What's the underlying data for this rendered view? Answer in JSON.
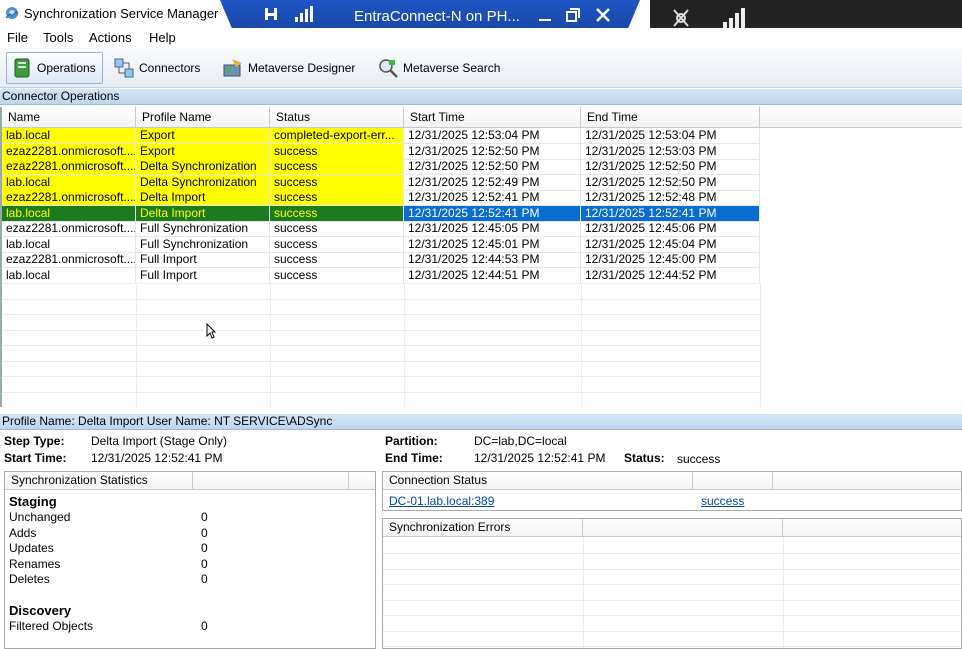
{
  "window": {
    "title": "Synchronization Service Manager",
    "rdp_title": "EntraConnect-N on PH..."
  },
  "menu": [
    "File",
    "Tools",
    "Actions",
    "Help"
  ],
  "toolbar": {
    "operations": "Operations",
    "connectors": "Connectors",
    "metaverse_designer": "Metaverse Designer",
    "metaverse_search": "Metaverse Search"
  },
  "connector_operations": {
    "header": "Connector Operations",
    "columns": [
      "Name",
      "Profile Name",
      "Status",
      "Start Time",
      "End Time"
    ],
    "rows": [
      {
        "name": "lab.local",
        "profile": "Export",
        "status": "completed-export-err...",
        "start": "12/31/2025 12:53:04 PM",
        "end": "12/31/2025 12:53:04 PM",
        "state": "yellow"
      },
      {
        "name": "ezaz2281.onmicrosoft....",
        "profile": "Export",
        "status": "success",
        "start": "12/31/2025 12:52:50 PM",
        "end": "12/31/2025 12:53:03 PM",
        "state": "yellow"
      },
      {
        "name": "ezaz2281.onmicrosoft....",
        "profile": "Delta Synchronization",
        "status": "success",
        "start": "12/31/2025 12:52:50 PM",
        "end": "12/31/2025 12:52:50 PM",
        "state": "yellow"
      },
      {
        "name": "lab.local",
        "profile": "Delta Synchronization",
        "status": "success",
        "start": "12/31/2025 12:52:49 PM",
        "end": "12/31/2025 12:52:50 PM",
        "state": "yellow"
      },
      {
        "name": "ezaz2281.onmicrosoft....",
        "profile": "Delta Import",
        "status": "success",
        "start": "12/31/2025 12:52:41 PM",
        "end": "12/31/2025 12:52:48 PM",
        "state": "yellow"
      },
      {
        "name": "lab.local",
        "profile": "Delta Import",
        "status": "success",
        "start": "12/31/2025 12:52:41 PM",
        "end": "12/31/2025 12:52:41 PM",
        "state": "selected"
      },
      {
        "name": "ezaz2281.onmicrosoft....",
        "profile": "Full Synchronization",
        "status": "success",
        "start": "12/31/2025 12:45:05 PM",
        "end": "12/31/2025 12:45:06 PM",
        "state": "normal"
      },
      {
        "name": "lab.local",
        "profile": "Full Synchronization",
        "status": "success",
        "start": "12/31/2025 12:45:01 PM",
        "end": "12/31/2025 12:45:04 PM",
        "state": "normal"
      },
      {
        "name": "ezaz2281.onmicrosoft....",
        "profile": "Full Import",
        "status": "success",
        "start": "12/31/2025 12:44:53 PM",
        "end": "12/31/2025 12:45:00 PM",
        "state": "normal"
      },
      {
        "name": "lab.local",
        "profile": "Full Import",
        "status": "success",
        "start": "12/31/2025 12:44:51 PM",
        "end": "12/31/2025 12:44:52 PM",
        "state": "normal"
      }
    ]
  },
  "details": {
    "header": "Profile Name: Delta Import  User Name: NT SERVICE\\ADSync",
    "step_type_label": "Step Type:",
    "step_type": "Delta Import (Stage Only)",
    "start_time_label": "Start Time:",
    "start_time": "12/31/2025 12:52:41 PM",
    "partition_label": "Partition:",
    "partition": "DC=lab,DC=local",
    "end_time_label": "End Time:",
    "end_time": "12/31/2025 12:52:41 PM",
    "status_label": "Status:",
    "status": "success"
  },
  "sync_stats": {
    "header": "Synchronization Statistics",
    "staging_label": "Staging",
    "staging": [
      {
        "label": "Unchanged",
        "value": "0"
      },
      {
        "label": "Adds",
        "value": "0"
      },
      {
        "label": "Updates",
        "value": "0"
      },
      {
        "label": "Renames",
        "value": "0"
      },
      {
        "label": "Deletes",
        "value": "0"
      }
    ],
    "discovery_label": "Discovery",
    "discovery": [
      {
        "label": "Filtered Objects",
        "value": "0"
      }
    ]
  },
  "connection_status": {
    "header": "Connection Status",
    "server": "DC-01.lab.local:389",
    "result": "success"
  },
  "sync_errors": {
    "header": "Synchronization Errors"
  }
}
